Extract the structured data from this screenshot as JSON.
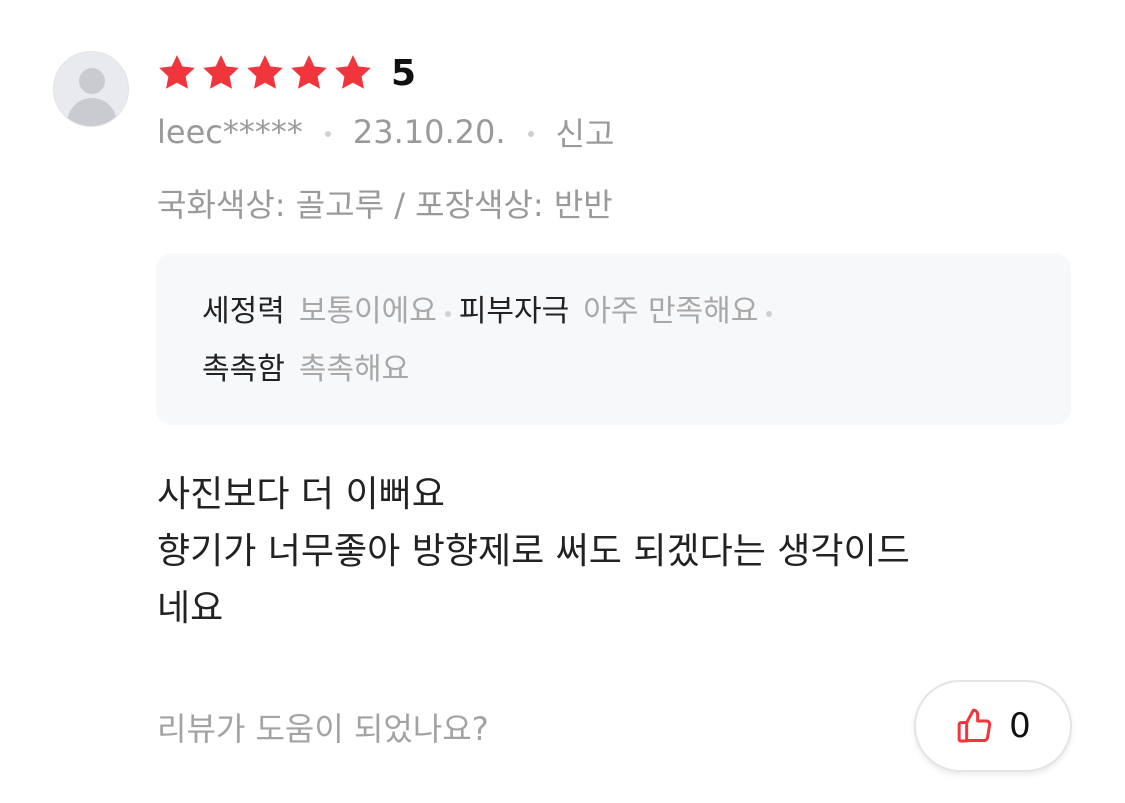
{
  "review": {
    "rating": {
      "stars_filled": 5,
      "stars_total": 5,
      "value": "5",
      "star_color": "#f0353c"
    },
    "author": "leec*****",
    "date": "23.10.20.",
    "report_label": "신고",
    "option_text": "국화색상: 골고루 / 포장색상: 반반",
    "evaluations": [
      {
        "key": "세정력",
        "value": "보통이에요"
      },
      {
        "key": "피부자극",
        "value": "아주 만족해요"
      },
      {
        "key": "촉촉함",
        "value": "촉촉해요"
      }
    ],
    "body_lines": [
      "사진보다 더 이뻐요",
      "향기가 너무좋아 방향제로 써도 되겠다는 생각이드",
      "네요"
    ],
    "helpful_question": "리뷰가 도움이 되었나요?",
    "like": {
      "count": "0",
      "icon": "thumbs-up-icon",
      "icon_color": "#f0353c"
    }
  }
}
